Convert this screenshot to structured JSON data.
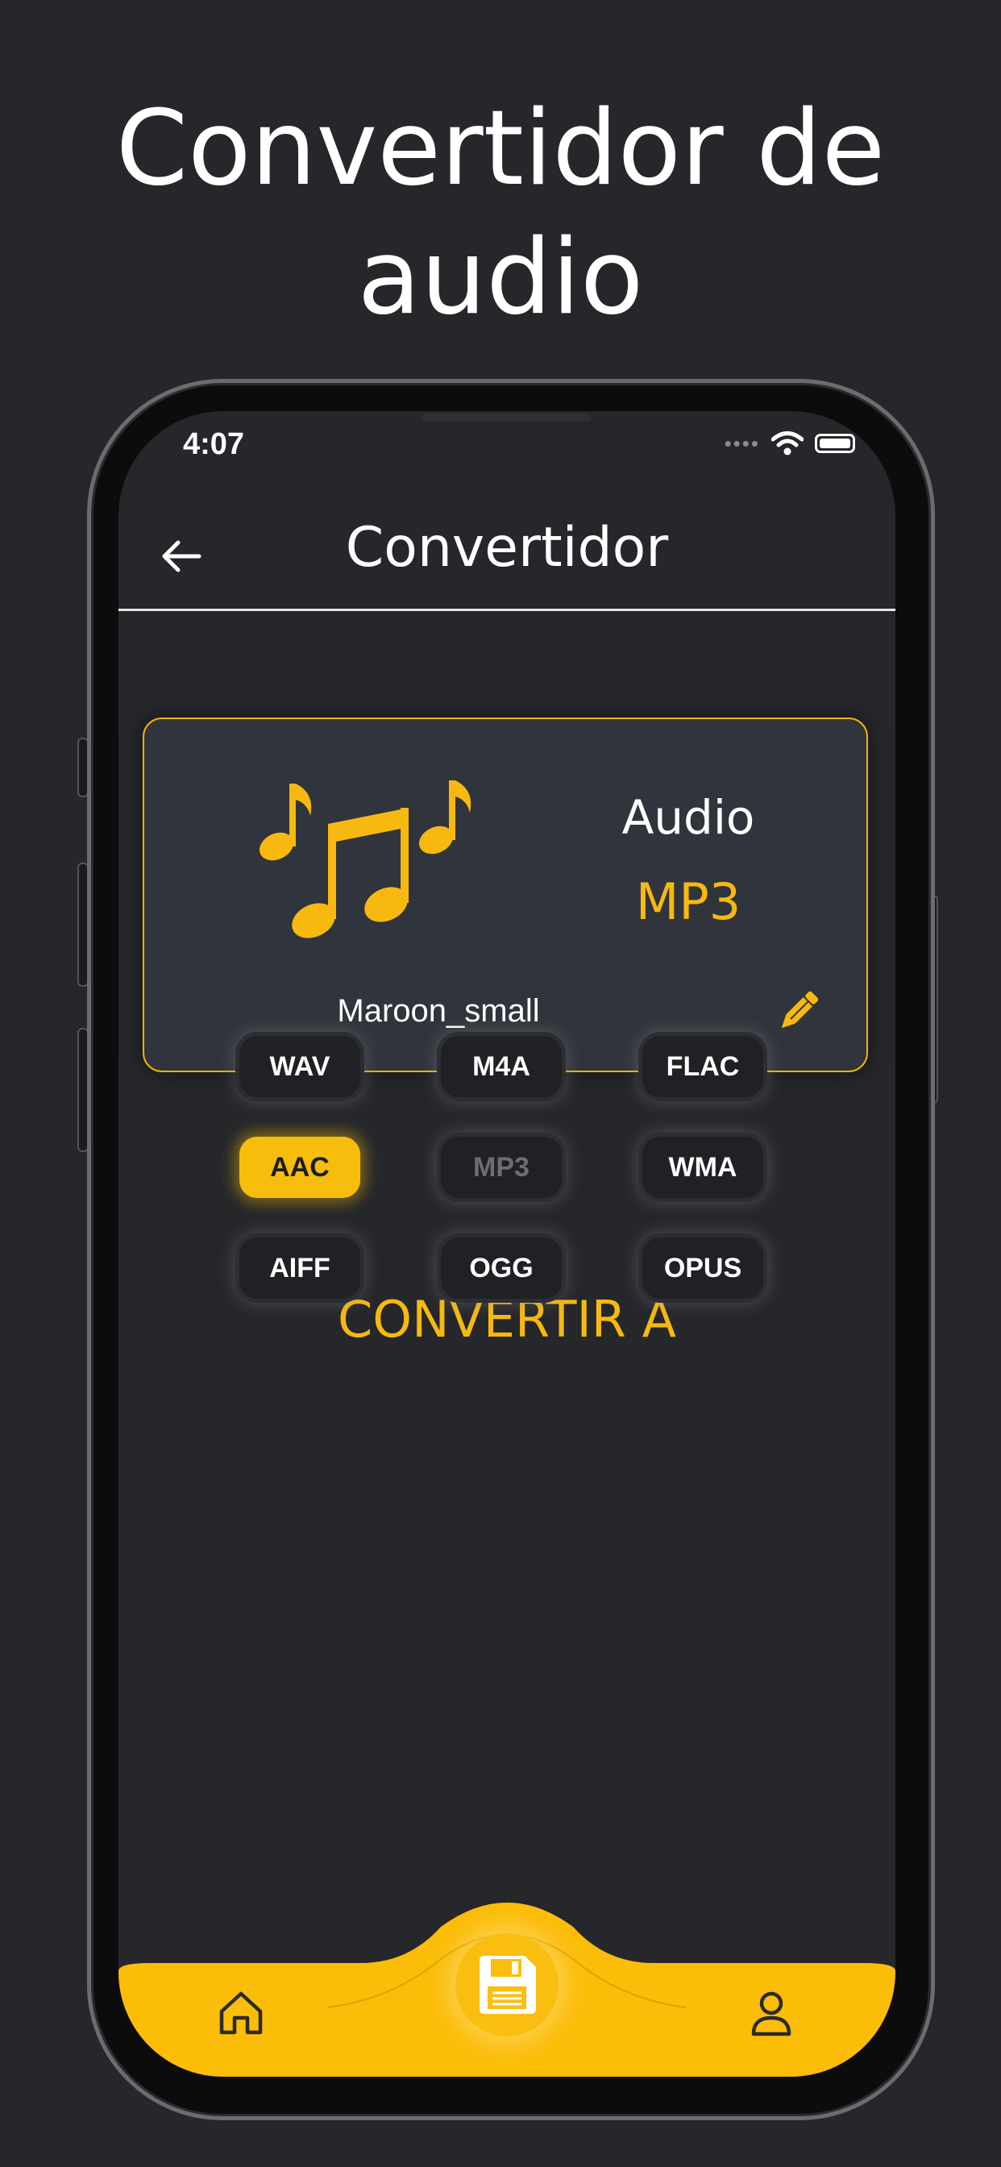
{
  "headline": "Convertidor de audio",
  "status": {
    "time": "4:07"
  },
  "nav": {
    "title": "Convertidor"
  },
  "card": {
    "kind": "Audio",
    "format": "MP3",
    "filename": "Maroon_small"
  },
  "section": {
    "title": "CONVERTIR A"
  },
  "formats": [
    {
      "label": "WAV",
      "state": "normal"
    },
    {
      "label": "M4A",
      "state": "normal"
    },
    {
      "label": "FLAC",
      "state": "normal"
    },
    {
      "label": "AAC",
      "state": "selected"
    },
    {
      "label": "MP3",
      "state": "disabled"
    },
    {
      "label": "WMA",
      "state": "normal"
    },
    {
      "label": "AIFF",
      "state": "normal"
    },
    {
      "label": "OGG",
      "state": "normal"
    },
    {
      "label": "OPUS",
      "state": "normal"
    }
  ],
  "tabbar": {
    "items": [
      "home-icon",
      "floppy-disk-icon",
      "user-icon"
    ]
  },
  "colors": {
    "accent": "#f7b910",
    "background": "#25272b",
    "card": "#30343c"
  }
}
